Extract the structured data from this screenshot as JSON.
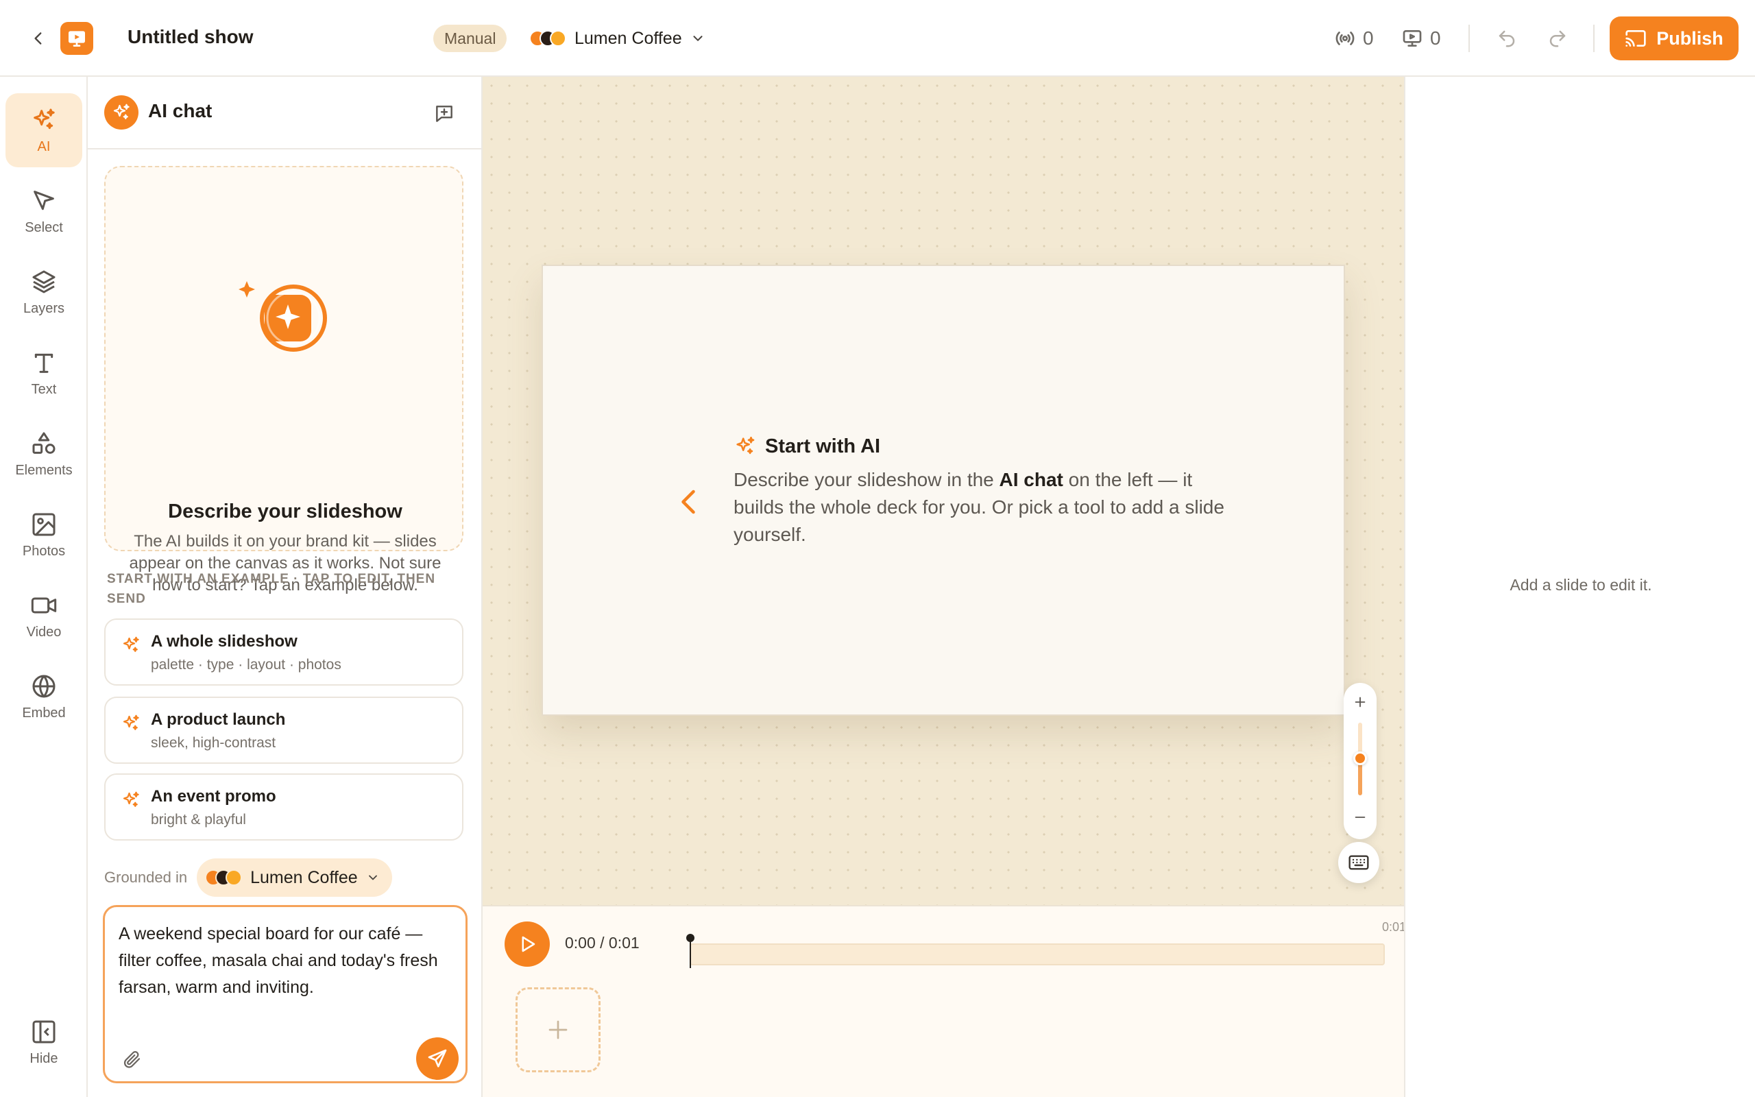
{
  "header": {
    "title": "Untitled show",
    "mode_badge": "Manual",
    "brand_name": "Lumen Coffee",
    "brand_colors": [
      "#f5821f",
      "#2a1d16",
      "#f9a825"
    ],
    "live_count": "0",
    "screen_count": "0",
    "publish_label": "Publish"
  },
  "sidebar": {
    "items": [
      {
        "label": "AI",
        "icon": "sparkle-icon"
      },
      {
        "label": "Select",
        "icon": "cursor-icon"
      },
      {
        "label": "Layers",
        "icon": "layers-icon"
      },
      {
        "label": "Text",
        "icon": "text-icon"
      },
      {
        "label": "Elements",
        "icon": "shapes-icon"
      },
      {
        "label": "Photos",
        "icon": "image-icon"
      },
      {
        "label": "Video",
        "icon": "video-icon"
      },
      {
        "label": "Embed",
        "icon": "globe-icon"
      }
    ],
    "hide_label": "Hide"
  },
  "chat": {
    "title": "AI chat",
    "intro_title": "Describe your slideshow",
    "intro_body": "The AI builds it on your brand kit — slides appear on the canvas as it works. Not sure how to start? Tap an example below.",
    "examples_label": "START WITH AN EXAMPLE · TAP TO EDIT, THEN SEND",
    "examples": [
      {
        "title": "A whole slideshow",
        "subtitle": "palette · type · layout · photos"
      },
      {
        "title": "A product launch",
        "subtitle": "sleek, high-contrast"
      },
      {
        "title": "An event promo",
        "subtitle": "bright & playful"
      }
    ],
    "grounded_label": "Grounded in",
    "grounded_brand": "Lumen Coffee",
    "composer_text": "A weekend special board for our café — filter coffee, masala chai and today's fresh farsan, warm and inviting."
  },
  "canvas": {
    "slide_heading": "Start with AI",
    "slide_body_1": "Describe your slideshow in the ",
    "slide_body_bold": "AI chat",
    "slide_body_2": " on the left — it builds the whole deck for you. Or pick a tool to add a slide yourself."
  },
  "timeline": {
    "time": "0:00 / 0:01",
    "end_marker": "0:01"
  },
  "inspector": {
    "empty_text": "Add a slide to edit it."
  },
  "colors": {
    "accent": "#f5821f",
    "canvas_bg": "#f3e9d3"
  }
}
